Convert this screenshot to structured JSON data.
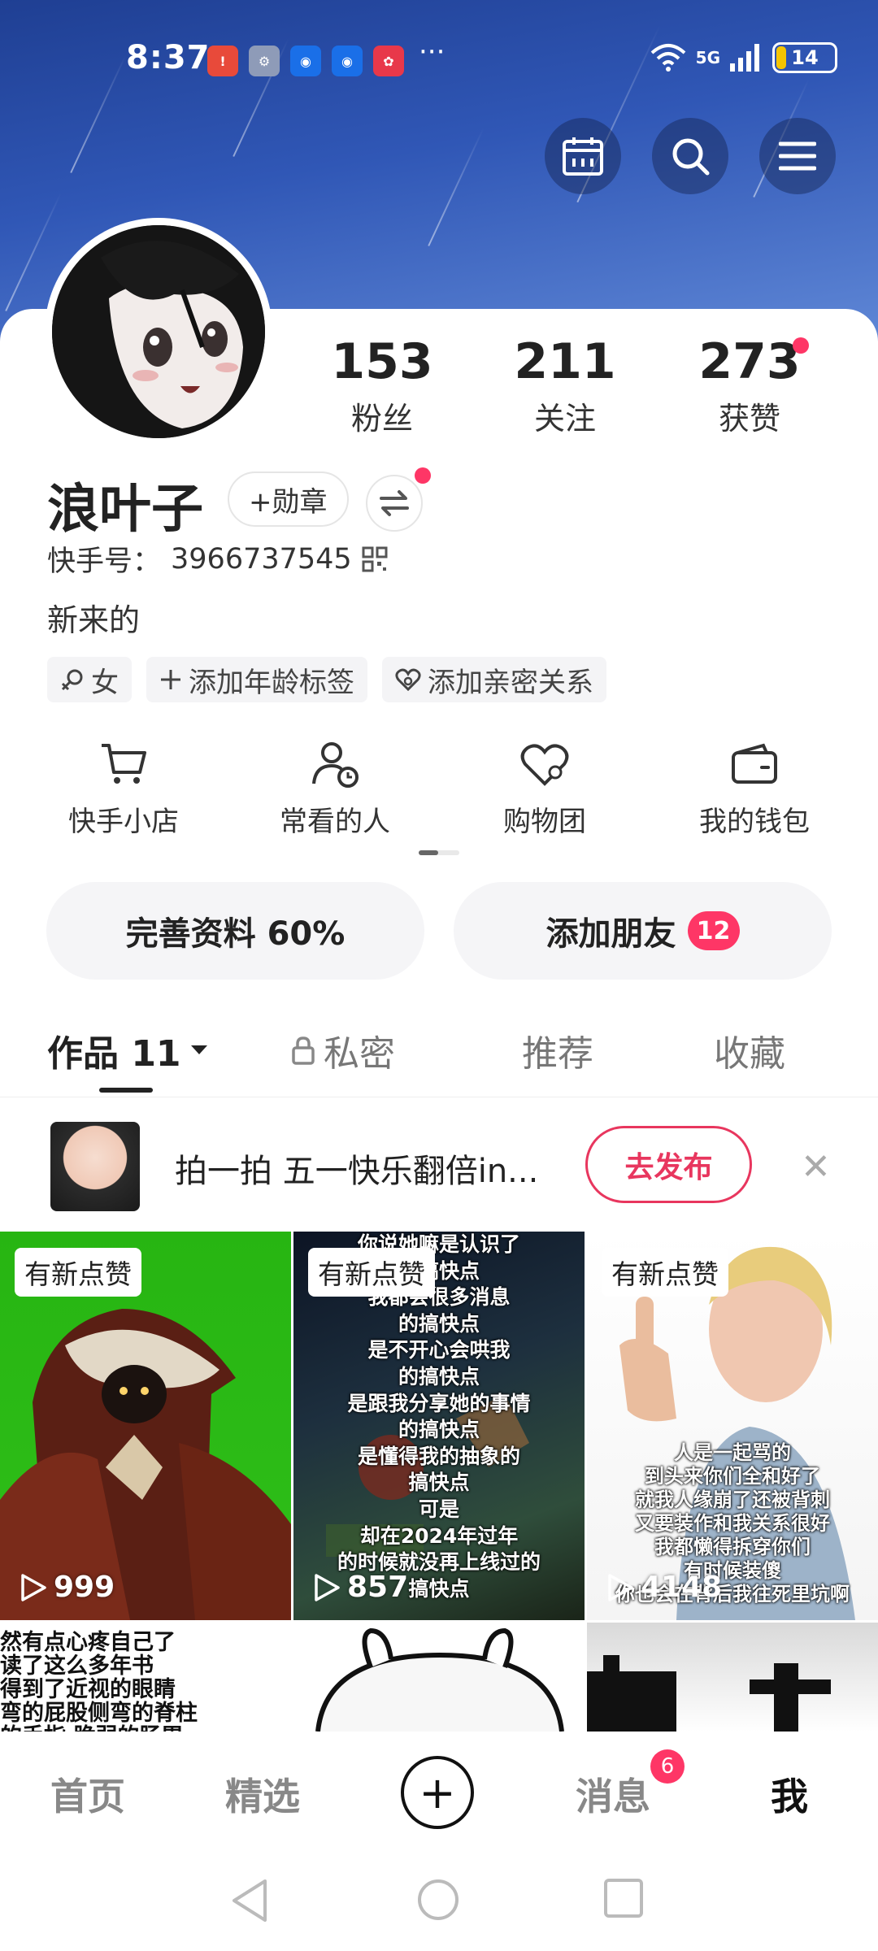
{
  "status_bar": {
    "time": "8:37",
    "network": "5G",
    "battery": "14",
    "more": "···"
  },
  "profile": {
    "name": "浪叶子",
    "badge_label": "+勋章",
    "kuaishou_id_label": "快手号：",
    "kuaishou_id": "3966737545",
    "bio": "新来的",
    "stats": [
      {
        "num": "153",
        "label": "粉丝"
      },
      {
        "num": "211",
        "label": "关注"
      },
      {
        "num": "273",
        "label": "获赞"
      }
    ]
  },
  "tags": [
    {
      "icon": "female-icon",
      "label": "女"
    },
    {
      "icon": "plus-icon",
      "label": "添加年龄标签"
    },
    {
      "icon": "heart-link-icon",
      "label": "添加亲密关系"
    }
  ],
  "shortcuts": [
    {
      "icon": "cart-icon",
      "label": "快手小店"
    },
    {
      "icon": "person-clock-icon",
      "label": "常看的人"
    },
    {
      "icon": "heart-group-icon",
      "label": "购物团"
    },
    {
      "icon": "wallet-icon",
      "label": "我的钱包"
    }
  ],
  "actions": {
    "complete_profile": "完善资料 60%",
    "add_friends": "添加朋友",
    "add_friends_count": "12"
  },
  "tabs": {
    "works": "作品 11",
    "private": "私密",
    "recommend": "推荐",
    "favorites": "收藏"
  },
  "promo": {
    "text": "拍一拍 五一快乐翻倍in...",
    "button": "去发布"
  },
  "grid": {
    "new_like_label": "有新点赞",
    "tiles": [
      {
        "plays": "999"
      },
      {
        "plays": "857",
        "caption": "你说她嘛是认识了\n的搞快点\n我都会很多消息\n的搞快点\n是不开心会哄我\n的搞快点\n是跟我分享她的事情\n的搞快点\n是懂得我的抽象的\n搞快点\n可是\n却在2024年过年\n的时候就没再上线过的\n搞快点"
      },
      {
        "plays": "4148",
        "caption": "人是一起骂的\n到头来你们全和好了\n就我人缘崩了还被背刺\n又要装作和我关系很好\n我都懒得拆穿你们\n有时候装傻\n你也会在背后我往死里坑啊"
      },
      {
        "caption": "然有点心疼自己了\n读了这么多年书\n得到了近视的眼睛\n弯的屁股侧弯的脊柱\n的手指 脆弱的肠胃"
      },
      {},
      {}
    ]
  },
  "bottom_nav": {
    "home": "首页",
    "featured": "精选",
    "messages": "消息",
    "messages_badge": "6",
    "me": "我"
  },
  "colors": {
    "accent": "#fe3666",
    "promo_red": "#e8365e",
    "hero_blue": "#2a4fae"
  }
}
